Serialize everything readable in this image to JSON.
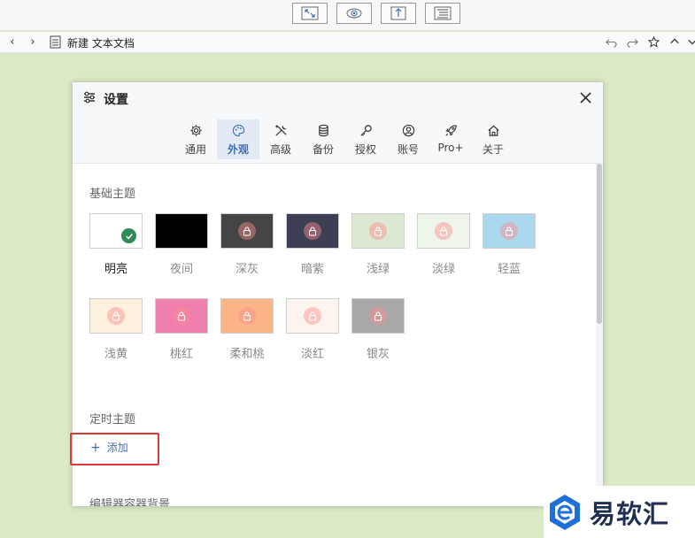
{
  "toolbar": {
    "buttons": [
      "fullscreen-icon",
      "eye-icon",
      "export-icon",
      "outline-icon"
    ]
  },
  "tabbar": {
    "back": "‹",
    "forward": "›",
    "doc_title": "新建 文本文档",
    "actions": [
      "undo-icon",
      "redo-icon",
      "star-icon",
      "chevron-up-icon",
      "chevron-down-icon"
    ]
  },
  "dialog": {
    "title": "设置",
    "tabs": [
      {
        "label": "通用",
        "icon": "gear-icon",
        "active": false
      },
      {
        "label": "外观",
        "icon": "palette-icon",
        "active": true
      },
      {
        "label": "高级",
        "icon": "tools-icon",
        "active": false
      },
      {
        "label": "备份",
        "icon": "database-icon",
        "active": false
      },
      {
        "label": "授权",
        "icon": "key-icon",
        "active": false
      },
      {
        "label": "账号",
        "icon": "user-icon",
        "active": false
      },
      {
        "label": "Pro+",
        "icon": "rocket-icon",
        "active": false
      },
      {
        "label": "关于",
        "icon": "home-icon",
        "active": false
      }
    ],
    "basic_theme": {
      "title": "基础主题",
      "themes": [
        {
          "label": "明亮",
          "color": "#ffffff",
          "selected": true,
          "locked": false
        },
        {
          "label": "夜间",
          "color": "#000000",
          "selected": false,
          "locked": false
        },
        {
          "label": "深灰",
          "color": "#444444",
          "selected": false,
          "locked": true
        },
        {
          "label": "暗紫",
          "color": "#3d3f55",
          "selected": false,
          "locked": true
        },
        {
          "label": "浅绿",
          "color": "#dde8d2",
          "selected": false,
          "locked": true
        },
        {
          "label": "淡绿",
          "color": "#eef6ec",
          "selected": false,
          "locked": true
        },
        {
          "label": "轻蓝",
          "color": "#a9d8ef",
          "selected": false,
          "locked": true
        },
        {
          "label": "浅黄",
          "color": "#fdf0dd",
          "selected": false,
          "locked": true
        },
        {
          "label": "桃红",
          "color": "#ef7fad",
          "selected": false,
          "locked": true
        },
        {
          "label": "柔和桃",
          "color": "#fbb589",
          "selected": false,
          "locked": true
        },
        {
          "label": "淡红",
          "color": "#fdf4f0",
          "selected": false,
          "locked": true
        },
        {
          "label": "银灰",
          "color": "#a8a8a8",
          "selected": false,
          "locked": true
        }
      ]
    },
    "timed_theme": {
      "title": "定时主题",
      "add_label": "添加"
    },
    "editor_bg_title": "编辑器容器背景"
  },
  "watermark": {
    "text": "易软汇",
    "logo": "brand-logo"
  },
  "colors": {
    "accent": "#3d6fb8",
    "background": "#dbe9c7",
    "annotation": "#d93a3a",
    "check": "#2e8b57"
  }
}
